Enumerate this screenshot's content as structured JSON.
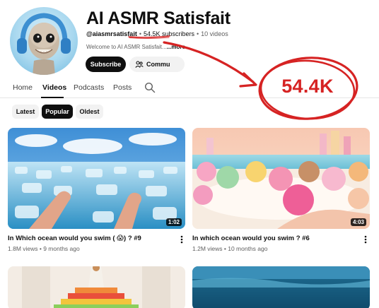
{
  "channel": {
    "name": "AI ASMR Satisfait",
    "handle": "@aiasmrsatisfait",
    "subscribers": "54.5K subscribers",
    "videos": "10 videos",
    "separator": "•",
    "description": "Welcome to AI ASMR Satisfait...",
    "more": "...more",
    "subscribe_label": "Subscribe",
    "community_label": "Commu"
  },
  "tabs": [
    {
      "label": "Home"
    },
    {
      "label": "Videos"
    },
    {
      "label": "Podcasts"
    },
    {
      "label": "Posts"
    }
  ],
  "filters": [
    {
      "label": "Latest"
    },
    {
      "label": "Popular"
    },
    {
      "label": "Oldest"
    }
  ],
  "videos": [
    {
      "title": "In Which ocean would you swim ( 😱) ? #9",
      "meta": "1.8M views • 9 months ago",
      "duration": "1:02"
    },
    {
      "title": "In which ocean would you swim ? #6",
      "meta": "1.2M views • 10 months ago",
      "duration": "4:03"
    }
  ],
  "annotation": {
    "text": "54.4K",
    "color": "#d62323"
  },
  "colors": {
    "accent": "#0f0f0f",
    "annotation_red": "#d62323"
  },
  "icons": [
    "search-icon",
    "community-icon",
    "more-vert-icon"
  ]
}
